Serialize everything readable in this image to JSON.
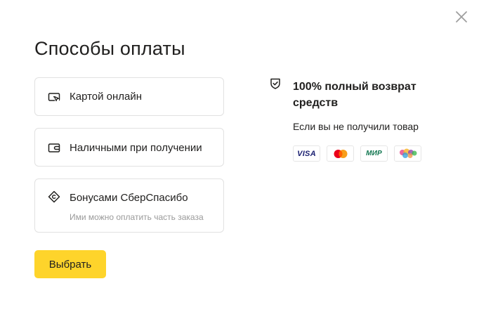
{
  "dialog": {
    "title": "Способы оплаты"
  },
  "options": {
    "card": {
      "label": "Картой онлайн",
      "icon": "card-online-icon"
    },
    "cash": {
      "label": "Наличными при получении",
      "icon": "wallet-icon"
    },
    "bonus": {
      "label": "Бонусами СберСпасибо",
      "sublabel": "Ими можно оплатить часть заказа",
      "icon": "sberspasibo-icon"
    }
  },
  "actions": {
    "select_label": "Выбрать"
  },
  "refund": {
    "icon": "shield-check-icon",
    "title": "100% полный возврат средств",
    "subtitle": "Если вы не получили товар"
  },
  "payment_logos": {
    "visa": "VISA",
    "mastercard": "mastercard-logo",
    "mir": "МИР",
    "spasibo": "sberspasibo-logo"
  },
  "colors": {
    "accent_button": "#fed42b",
    "text_primary": "#21201f",
    "text_secondary": "#9a9a9a",
    "border": "#e1e1e1",
    "visa_blue": "#1a1f71",
    "mir_green": "#0f754e"
  }
}
